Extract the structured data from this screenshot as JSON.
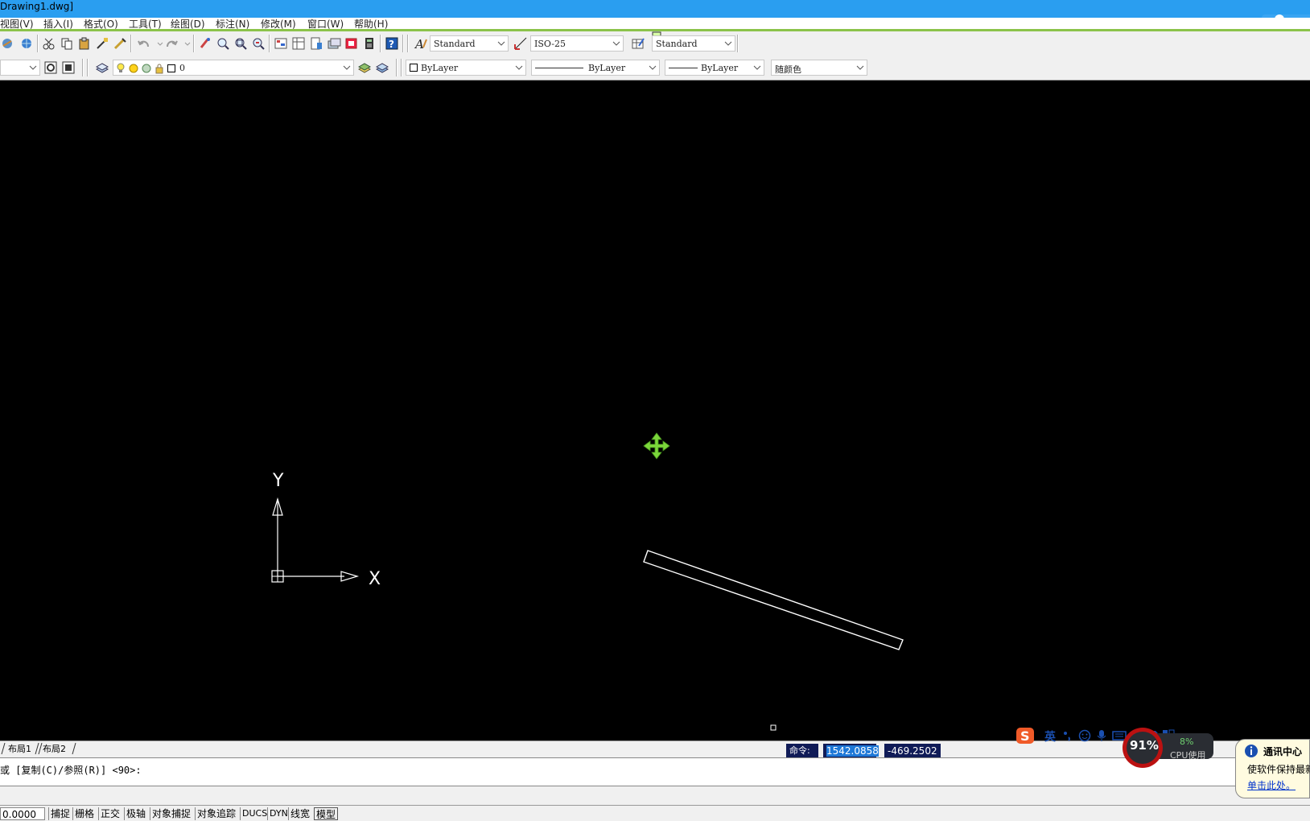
{
  "window": {
    "title": "Drawing1.dwg]"
  },
  "menu": [
    "视图(V)",
    "插入(I)",
    "格式(O)",
    "工具(T)",
    "绘图(D)",
    "标注(N)",
    "修改(M)",
    "窗口(W)",
    "帮助(H)"
  ],
  "toolbar": {
    "text_style": "Standard",
    "dim_style": "ISO-25",
    "table_style": "Standard",
    "layer_name": "0",
    "color": "ByLayer",
    "linetype": "ByLayer",
    "lineweight": "ByLayer",
    "plot_style": "随颜色"
  },
  "canvas": {
    "ucs_x_label": "X",
    "ucs_y_label": "Y"
  },
  "layout_tabs": [
    "布局1",
    "布局2"
  ],
  "coords": {
    "label": "命令:",
    "x": "1542.0858",
    "y": "-469.2502"
  },
  "command_line": {
    "text": "或 [复制(C)/参照(R)] <90>:"
  },
  "status": {
    "coord_readout": "0.0000",
    "buttons": [
      "捕捉",
      "栅格",
      "正交",
      "极轴",
      "对象捕捉",
      "对象追踪",
      "DUCS",
      "DYN",
      "线宽",
      "模型"
    ]
  },
  "ime": {
    "mode": "英"
  },
  "cpu": {
    "percent": "91%",
    "mem_percent": "8%",
    "label": "CPU使用"
  },
  "notification": {
    "title": "通讯中心",
    "line": "使软件保持最新",
    "link": "单击此处。"
  },
  "colors": {
    "title_bar": "#2a9ef0",
    "canvas": "#000000",
    "cursor": "#7cd63b",
    "coord_bg": "#101b57"
  }
}
